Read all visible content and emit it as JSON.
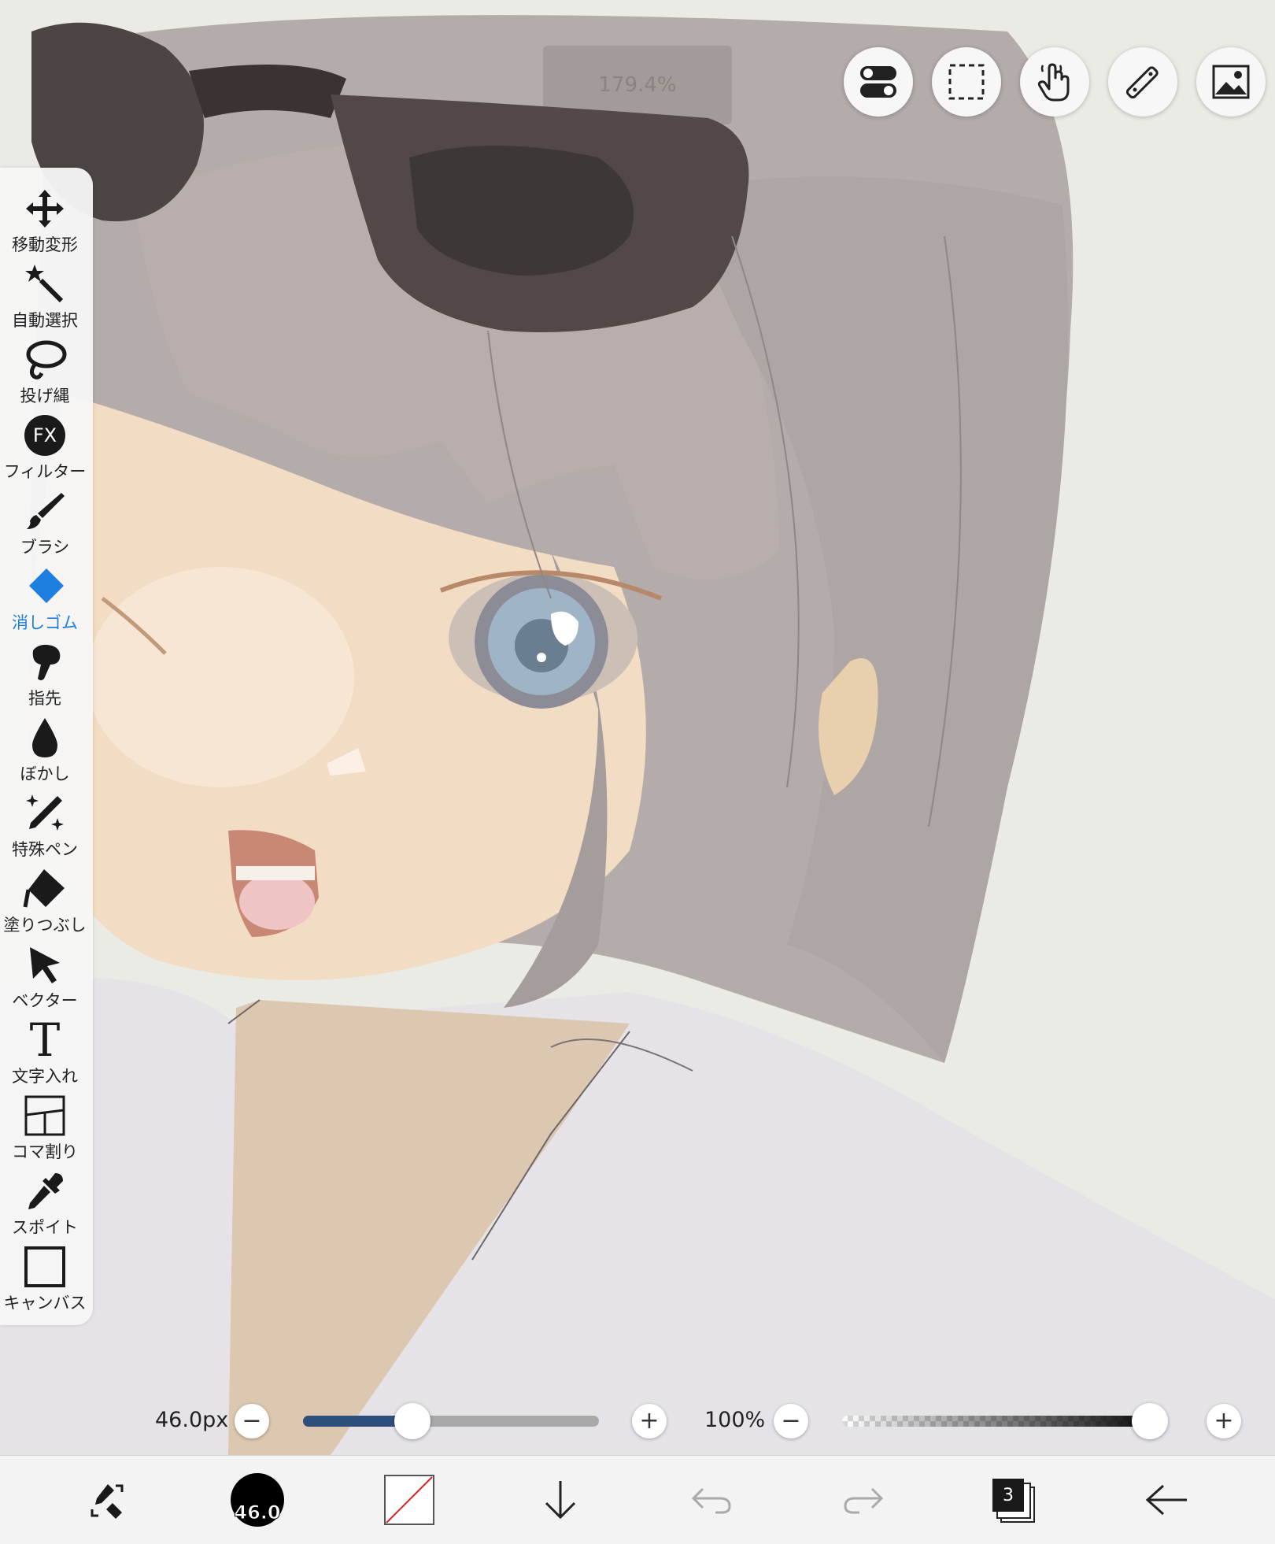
{
  "zoom_indicator": "179.4%",
  "tools": [
    {
      "label": "移動変形",
      "icon": "move-icon"
    },
    {
      "label": "自動選択",
      "icon": "magic-wand-icon"
    },
    {
      "label": "投げ縄",
      "icon": "lasso-icon"
    },
    {
      "label": "フィルター",
      "icon": "fx-icon",
      "glyph": "FX"
    },
    {
      "label": "ブラシ",
      "icon": "brush-icon"
    },
    {
      "label": "消しゴム",
      "icon": "eraser-icon",
      "active": true
    },
    {
      "label": "指先",
      "icon": "finger-icon"
    },
    {
      "label": "ぼかし",
      "icon": "blur-drop-icon"
    },
    {
      "label": "特殊ペン",
      "icon": "special-pen-icon"
    },
    {
      "label": "塗りつぶし",
      "icon": "fill-bucket-icon"
    },
    {
      "label": "ベクター",
      "icon": "vector-arrow-icon"
    },
    {
      "label": "文字入れ",
      "icon": "text-icon",
      "glyph": "T"
    },
    {
      "label": "コマ割り",
      "icon": "frame-split-icon"
    },
    {
      "label": "スポイト",
      "icon": "eyedropper-icon"
    },
    {
      "label": "キャンバス",
      "icon": "canvas-icon"
    }
  ],
  "brush_size": {
    "value_label": "46.0px",
    "minus": "−",
    "plus": "+",
    "fraction": 0.37
  },
  "opacity": {
    "value_label": "100%",
    "minus": "−",
    "plus": "+",
    "fraction": 1.0
  },
  "bottom_bar": {
    "brush_preview_label": "46.0",
    "layers_count": "3"
  },
  "colors": {
    "accent": "#1e7fe0",
    "slider_fill": "#2d4f7a",
    "toolbar_bg": "#f6f6f6"
  }
}
